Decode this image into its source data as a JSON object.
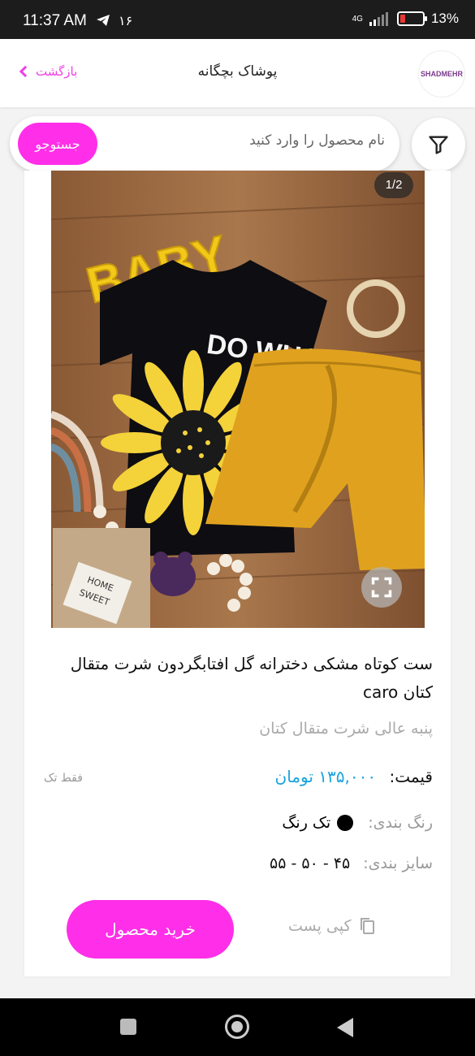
{
  "status_bar": {
    "time": "11:37 AM",
    "date": "۱۶",
    "network": "4G",
    "battery": "13%",
    "battery_level": 0.13
  },
  "header": {
    "logo_text": "SHADMEHR",
    "title": "پوشاک بچگانه",
    "back_label": "بازگشت",
    "accent_color": "#ee3fe6"
  },
  "search": {
    "placeholder": "نام محصول را وارد کنید",
    "button_label": "جستوجو",
    "button_color": "#ff2ee8"
  },
  "product": {
    "image_counter": "1/2",
    "image_text": {
      "baby": "BABY",
      "shirt": "DO WHAT",
      "tag_line1": "HOME",
      "tag_line2": "SWEET"
    },
    "title": "ست کوتاه مشکی دخترانه گل افتابگردون شرت متقال کتان caro",
    "subtitle": "پنبه عالی شرت متقال کتان",
    "price_label": "قیمت:",
    "price_value": "۱۳۵,۰۰۰ تومان",
    "price_color": "#1aa3dc",
    "only_one": "فقط تک",
    "color_label": "رنگ بندی:",
    "color_value": "تک رنگ",
    "size_label": "سایز بندی:",
    "size_value": "۴۵ - ۵۰ - ۵۵",
    "copy_label": "کپی پست",
    "buy_label": "خرید محصول"
  }
}
